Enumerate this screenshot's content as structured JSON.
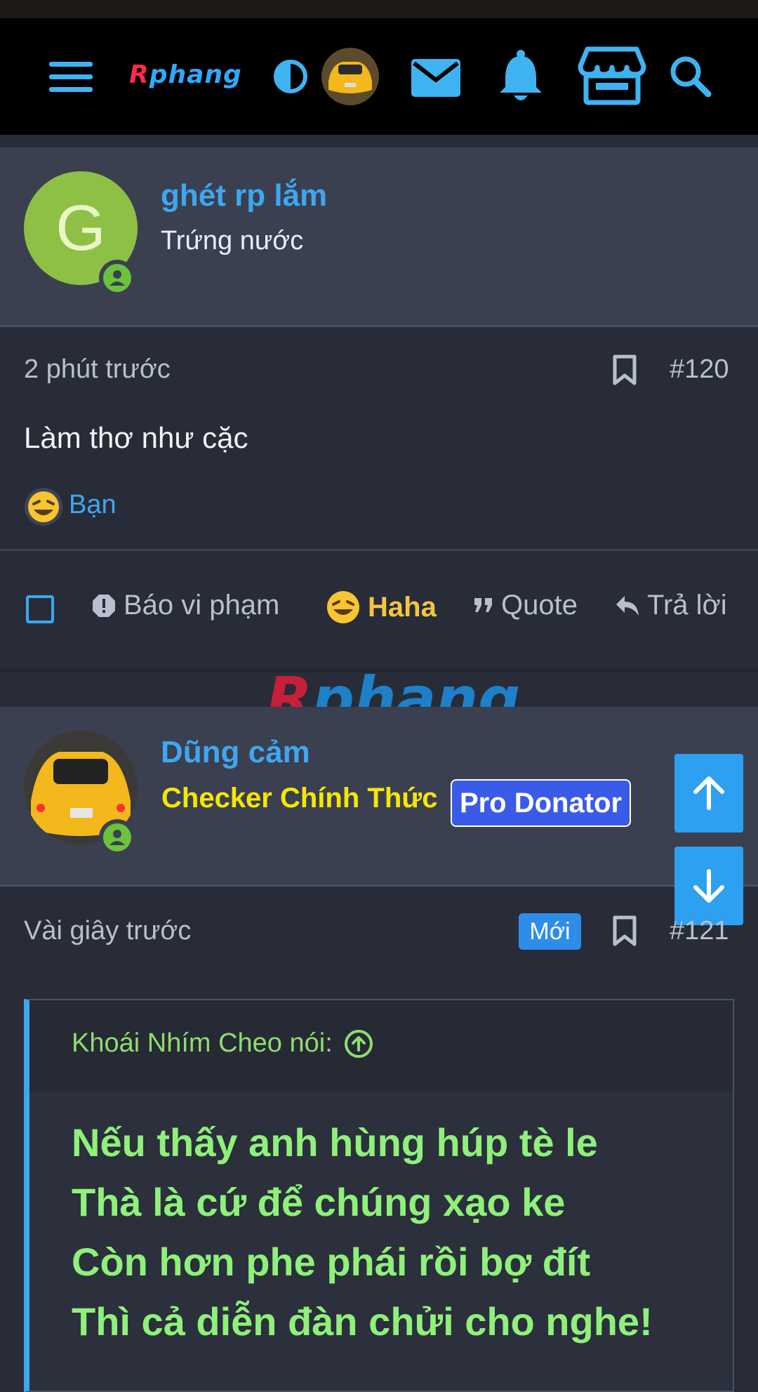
{
  "header": {
    "logo_text_r": "R",
    "logo_text_rest": "phang",
    "icons": [
      "menu-icon",
      "contrast-icon",
      "avatar",
      "mail-icon",
      "bell-icon",
      "store-icon",
      "search-icon"
    ]
  },
  "post120": {
    "avatar_letter": "G",
    "username": "ghét rp lắm",
    "user_title": "Trứng nước",
    "time": "2 phút trước",
    "number": "#120",
    "body": "Làm thơ như cặc",
    "reaction_by": "Bạn",
    "actions": {
      "report": "Báo vi phạm",
      "haha": "Haha",
      "quote": "Quote",
      "reply": "Trả lời"
    }
  },
  "watermark": {
    "r": "R",
    "rest": "phang"
  },
  "post121": {
    "username": "Dũng cảm",
    "user_title": "Checker Chính Thức",
    "donator_badge": "Pro Donator",
    "time": "Vài giây trước",
    "new_badge": "Mới",
    "number": "#121",
    "quote_author": "Khoái Nhím Cheo nói:",
    "quote_lines": [
      "Nếu thấy anh hùng húp tè le",
      "Thà là cứ để chúng xạo ke",
      "Còn hơn phe phái rồi bợ đít",
      "Thì cả diễn đàn chửi cho nghe!"
    ]
  },
  "colors": {
    "accent": "#3fa6f0",
    "header_bg": "#3a4050",
    "body_bg": "#272c38",
    "quote_text": "#8ff07a",
    "checker": "#f5e800",
    "haha": "#f5c542"
  }
}
